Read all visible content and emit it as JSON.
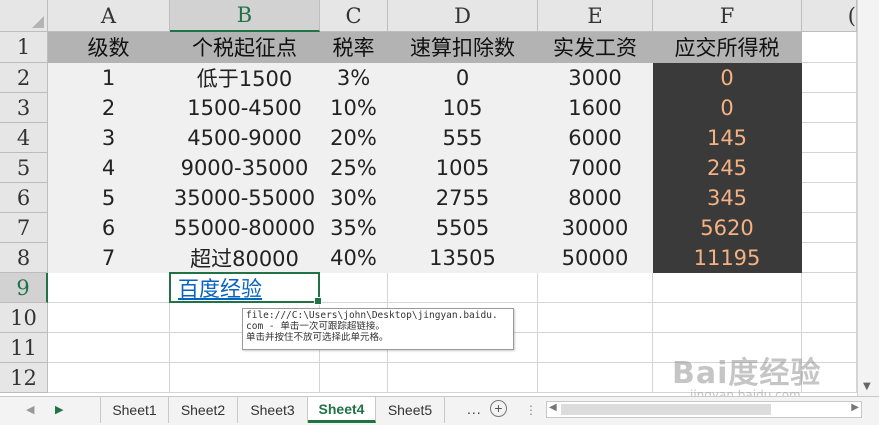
{
  "columns": [
    "A",
    "B",
    "C",
    "D",
    "E",
    "F",
    "("
  ],
  "rows": [
    "1",
    "2",
    "3",
    "4",
    "5",
    "6",
    "7",
    "8",
    "9",
    "10",
    "11",
    "12"
  ],
  "header_row": [
    "级数",
    "个税起征点",
    "税率",
    "速算扣除数",
    "实发工资",
    "应交所得税"
  ],
  "table": [
    [
      "1",
      "低于1500",
      "3%",
      "0",
      "3000",
      "0"
    ],
    [
      "2",
      "1500-4500",
      "10%",
      "105",
      "1600",
      "0"
    ],
    [
      "3",
      "4500-9000",
      "20%",
      "555",
      "6000",
      "145"
    ],
    [
      "4",
      "9000-35000",
      "25%",
      "1005",
      "7000",
      "245"
    ],
    [
      "5",
      "35000-55000",
      "30%",
      "2755",
      "8000",
      "345"
    ],
    [
      "6",
      "55000-80000",
      "35%",
      "5505",
      "30000",
      "5620"
    ],
    [
      "7",
      "超过80000",
      "40%",
      "13505",
      "50000",
      "11195"
    ]
  ],
  "link_cell": "百度经验",
  "tooltip": {
    "line1": "file:///C:\\Users\\john\\Desktop\\jingyan.baidu.",
    "line2": "com - 单击一次可跟踪超链接。",
    "line3": "单击并按住不放可选择此单元格。"
  },
  "sheets": [
    "Sheet1",
    "Sheet2",
    "Sheet3",
    "Sheet4",
    "Sheet5"
  ],
  "active_sheet": "Sheet4",
  "more_tabs": "...",
  "add_sheet": "+",
  "watermark": {
    "big": "Bai度经验",
    "small": "jingyan.baidu.com"
  },
  "colors": {
    "header_bg": "#b3b3b3",
    "light_bg": "#f0f0f0",
    "dark_bg": "#3a3a3a",
    "dark_text": "#f4b183",
    "link": "#0563c1",
    "accent": "#217346"
  }
}
